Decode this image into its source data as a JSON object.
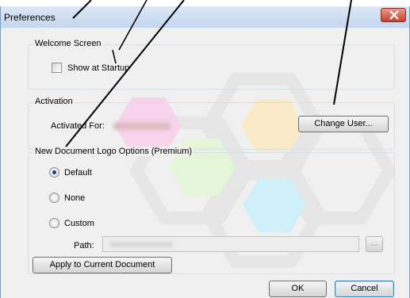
{
  "window": {
    "title": "Preferences"
  },
  "welcome": {
    "group_label": "Welcome Screen",
    "show_startup_label": "Show at Startup",
    "show_startup_checked": false
  },
  "activation": {
    "group_label": "Activation",
    "activated_for_label": "Activated For:",
    "change_user_label": "Change User..."
  },
  "logo": {
    "group_label": "New Document Logo Options (Premium)",
    "options": [
      "Default",
      "None",
      "Custom"
    ],
    "selected": "Default",
    "path_label": "Path:",
    "browse_label": "...",
    "apply_label": "Apply to Current Document"
  },
  "footer": {
    "ok_label": "OK",
    "cancel_label": "Cancel"
  }
}
